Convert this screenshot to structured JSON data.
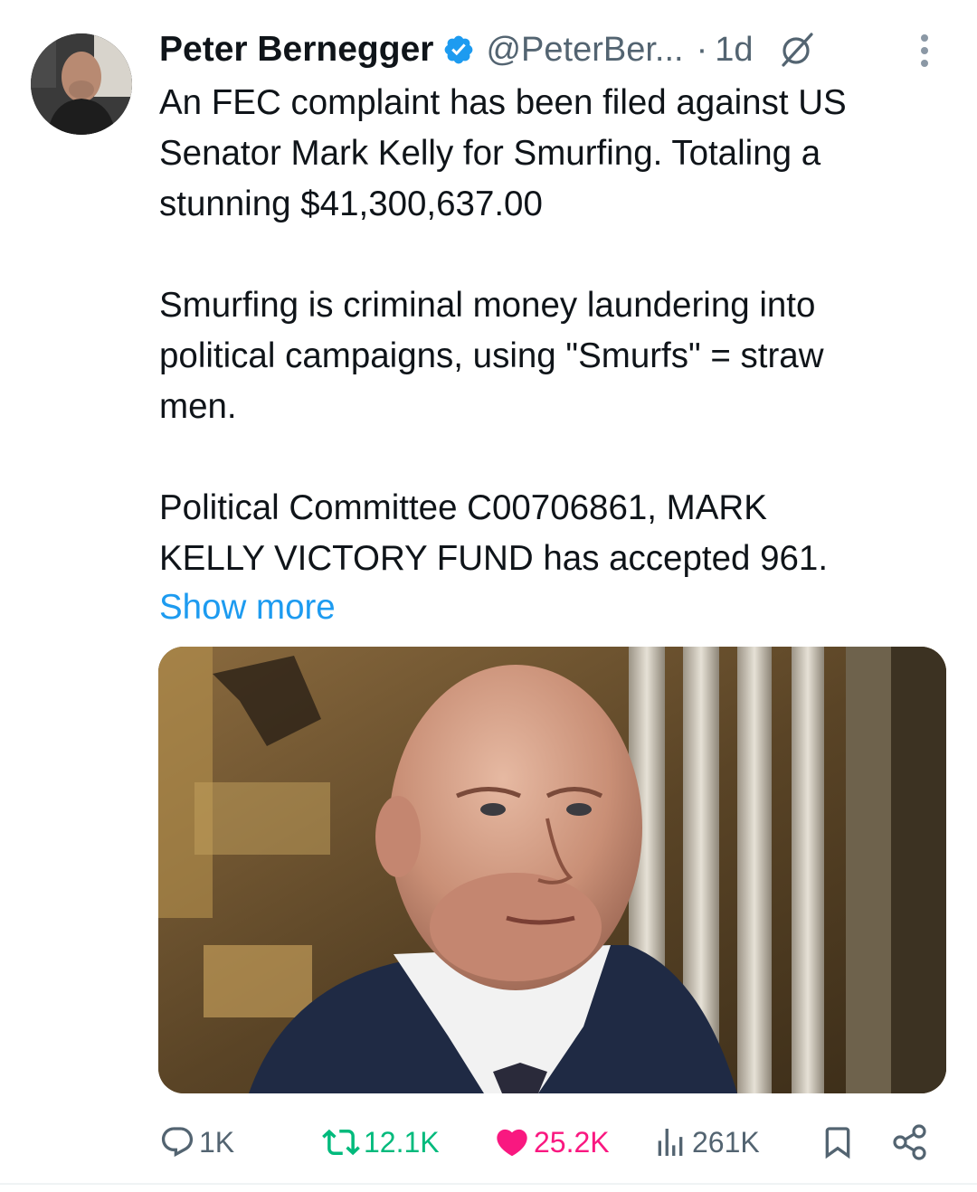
{
  "author": {
    "name": "Peter Bernegger",
    "handle": "@PeterBer...",
    "separator": "·",
    "time": "1d",
    "verified": true
  },
  "icons": {
    "verified": "verified-badge-icon",
    "grok": "grok-icon",
    "more": "more-vertical-icon",
    "reply": "reply-icon",
    "retweet": "retweet-icon",
    "like": "heart-filled-icon",
    "views": "views-icon",
    "bookmark": "bookmark-icon",
    "share": "share-icon"
  },
  "tweet": {
    "text": "An FEC complaint has been filed against US\nSenator Mark Kelly for Smurfing. Totaling a\nstunning $41,300,637.00\n\nSmurfing is criminal money laundering into\npolitical campaigns, using \"Smurfs\" = straw\nmen.\n\nPolitical Committee C00706861, MARK\nKELLY VICTORY FUND has accepted 961.",
    "show_more": "Show more"
  },
  "stats": {
    "replies": "1K",
    "retweets": "12.1K",
    "likes": "25.2K",
    "views": "261K"
  },
  "colors": {
    "text": "#0f1419",
    "secondary": "#536471",
    "link": "#1d9bf0",
    "retweet_active": "#00ba7c",
    "like_active": "#f91880",
    "verified_badge": "#1d9bf0"
  }
}
